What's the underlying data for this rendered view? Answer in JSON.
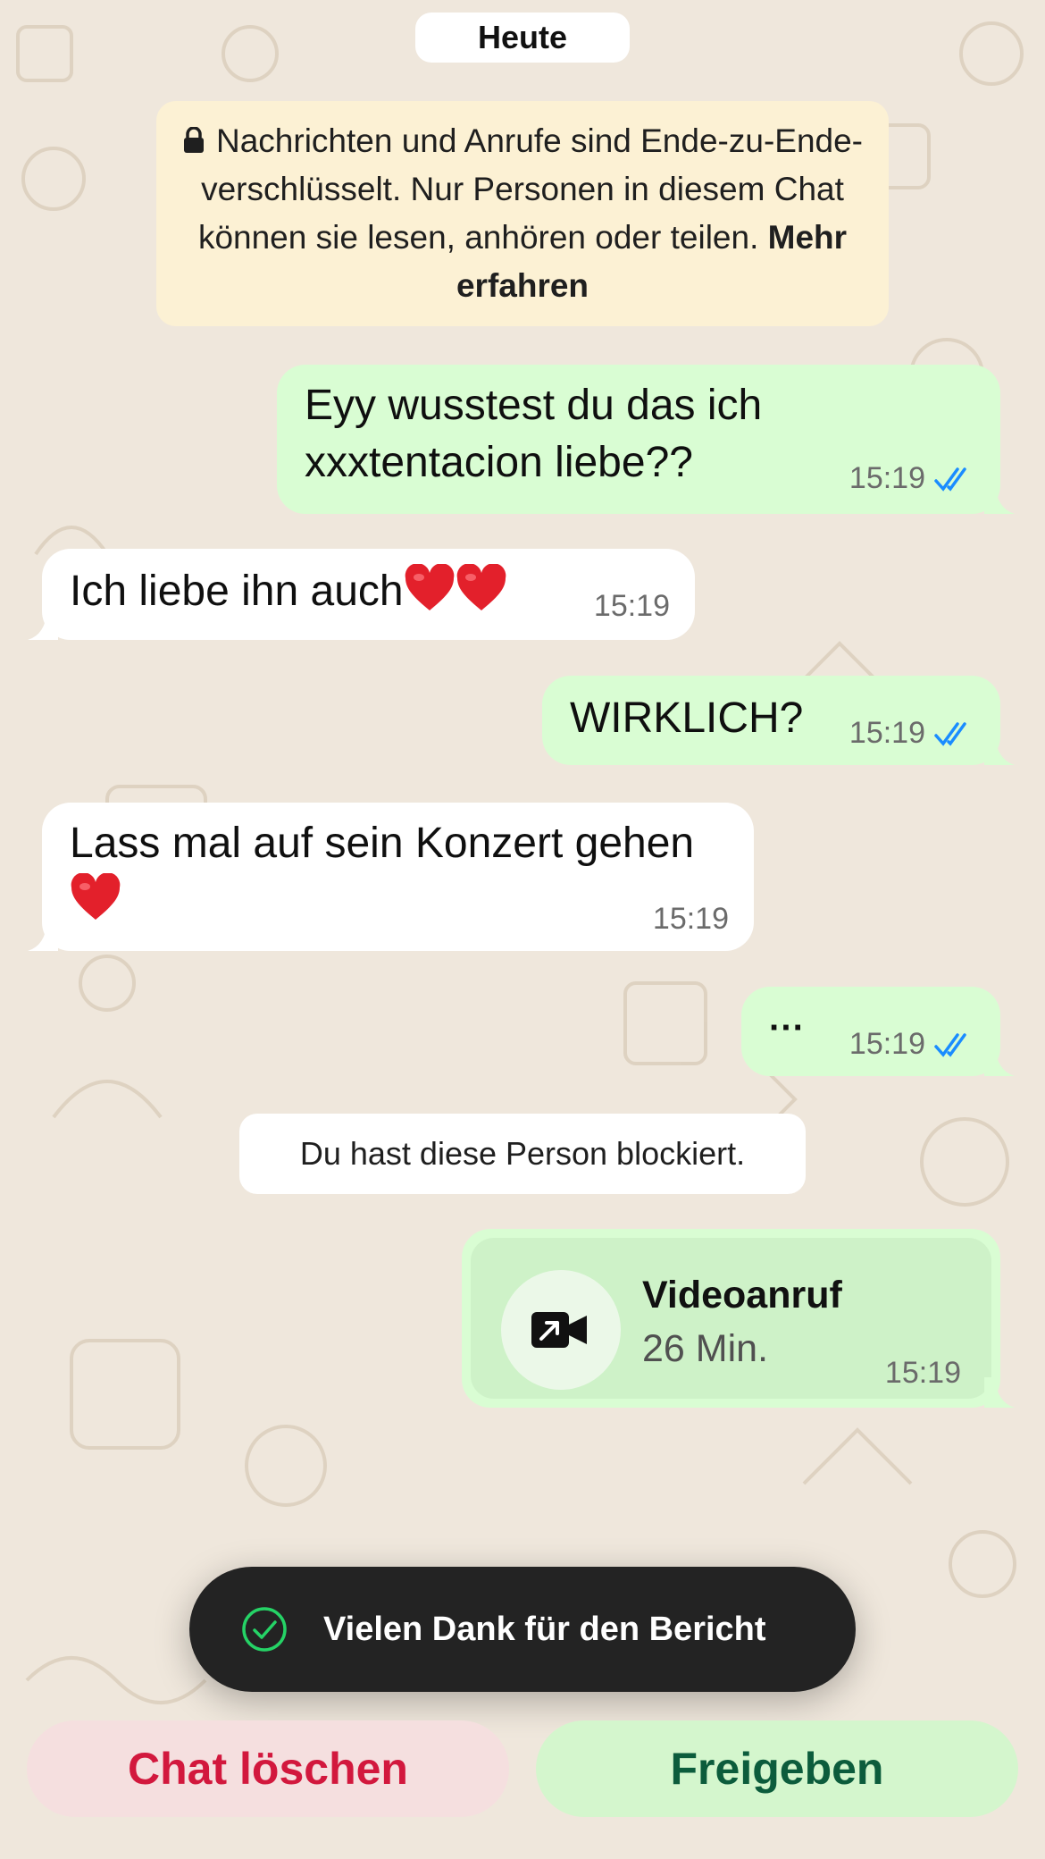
{
  "chat": {
    "date_label": "Heute",
    "encryption_notice": {
      "text": "Nachrichten und Anrufe sind Ende-zu-Ende-verschlüsselt. Nur Personen in diesem Chat können sie lesen, anhören oder teilen.",
      "link": "Mehr erfahren"
    },
    "messages": [
      {
        "direction": "out",
        "line1": "Eyy wusstest du das ich",
        "line2": "xxxtentacion liebe??",
        "time": "15:19",
        "status": "read"
      },
      {
        "direction": "in",
        "text": "Ich liebe ihn auch",
        "emoji": "❤️❤️",
        "time": "15:19"
      },
      {
        "direction": "out",
        "text": "WIRKLICH?",
        "time": "15:19",
        "status": "read"
      },
      {
        "direction": "in",
        "text": "Lass mal auf sein Konzert gehen",
        "emoji": "❤️",
        "time": "15:19"
      },
      {
        "direction": "out",
        "text": "···",
        "time": "15:19",
        "status": "read"
      }
    ],
    "system_message": "Du hast diese Person blockiert.",
    "call": {
      "icon": "video-call-outgoing-icon",
      "title": "Videoanruf",
      "duration": "26 Min.",
      "time": "15:19"
    }
  },
  "toast": {
    "icon": "check-circle-icon",
    "text": "Vielen Dank für den Bericht"
  },
  "actions": {
    "delete_label": "Chat löschen",
    "share_label": "Freigeben"
  },
  "colors": {
    "background": "#efe7dc",
    "outgoing_bubble": "#d9fdd3",
    "incoming_bubble": "#ffffff",
    "notice": "#fcf1d4",
    "read_ticks": "#1a8cff",
    "delete_text": "#d2183d",
    "share_text": "#0c5c3c",
    "toast_bg": "#232323",
    "toast_check": "#25d366"
  }
}
